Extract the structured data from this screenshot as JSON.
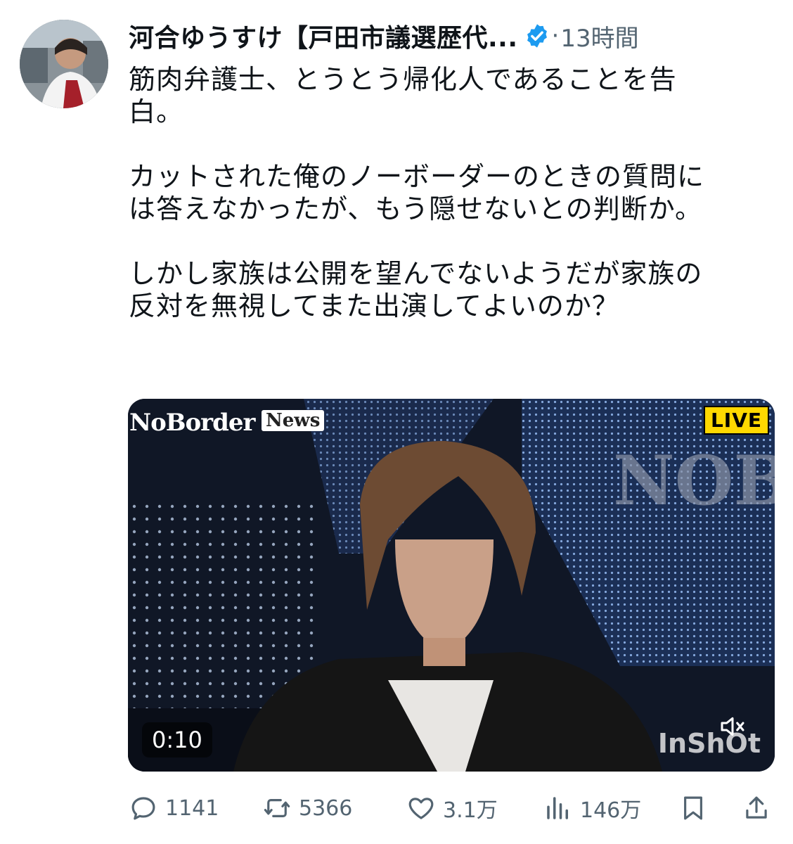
{
  "tweet": {
    "author_name": "河合ゆうすけ【戸田市議選歴代...",
    "time_separator": "·",
    "time": "13時間",
    "text": "筋肉弁護士、とうとう帰化人であることを告\n白。\n\nカットされた俺のノーボーダーのときの質問に\nは答えなかったが、もう隠せないとの判断か。\n\nしかし家族は公開を望んでないようだが家族の\n反対を無視してまた出演してよいのか？",
    "verified_color": "#1d9bf0"
  },
  "media": {
    "logo_text": "NoBorder",
    "logo_badge": "News",
    "live_label": "LIVE",
    "duration": "0:10",
    "watermark": "InShOt",
    "bg_logo_text": "NOBo"
  },
  "actions": {
    "replies": "1141",
    "retweets": "5366",
    "likes": "3.1万",
    "views": "146万"
  },
  "colors": {
    "secondary_text": "#536471",
    "primary_text": "#0f1419"
  }
}
